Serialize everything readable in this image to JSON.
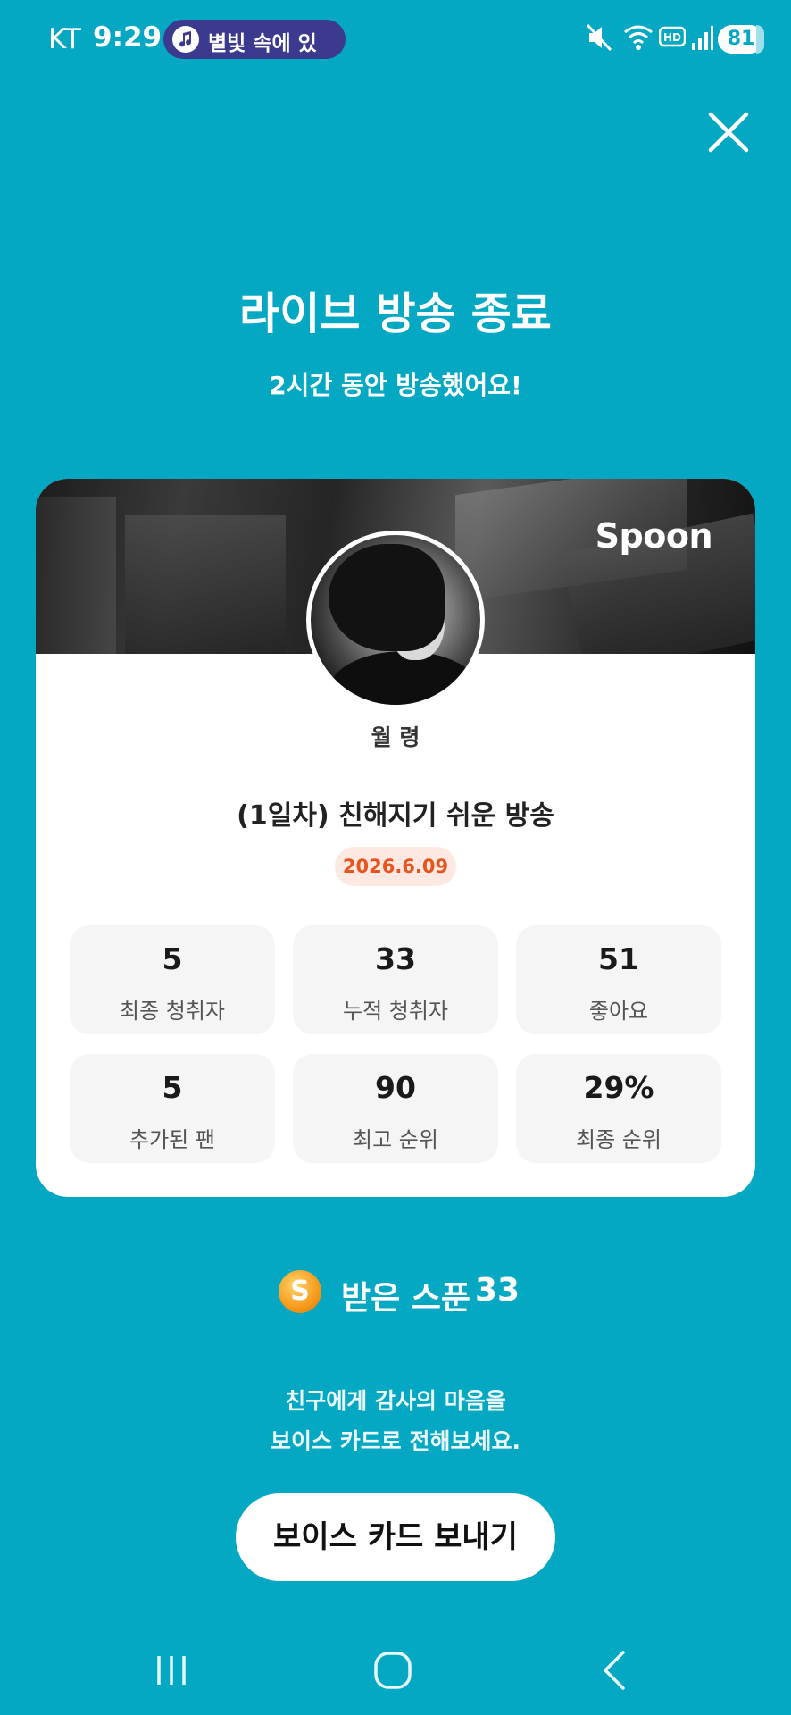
{
  "status_bar": {
    "carrier": "KT",
    "time": "9:29",
    "now_playing": "별빛 속에 있",
    "battery": "81",
    "icons": [
      "mute-icon",
      "wifi-icon",
      "hd-icon",
      "signal-icon"
    ]
  },
  "header": {
    "title": "라이브 방송 종료",
    "subtitle": "2시간 동안 방송했어요!"
  },
  "card": {
    "brand": "Spoon",
    "host_name": "월 령",
    "stream_title": "(1일차) 친해지기 쉬운 방송",
    "date": "2026.6.09",
    "stats": [
      {
        "value": "5",
        "label": "최종 청취자"
      },
      {
        "value": "33",
        "label": "누적 청취자"
      },
      {
        "value": "51",
        "label": "좋아요"
      },
      {
        "value": "5",
        "label": "추가된 팬"
      },
      {
        "value": "90",
        "label": "최고 순위"
      },
      {
        "value": "29%",
        "label": "최종 순위"
      }
    ]
  },
  "spoons": {
    "icon_letter": "S",
    "label": "받은 스푼",
    "count": "33"
  },
  "message": {
    "line1": "친구에게 감사의 마음을",
    "line2": "보이스 카드로 전해보세요."
  },
  "actions": {
    "voice_card_button": "보이스 카드 보내기"
  },
  "colors": {
    "background": "#04a8c2",
    "date_badge_text": "#e8531e",
    "date_badge_bg": "#fde8e2"
  }
}
